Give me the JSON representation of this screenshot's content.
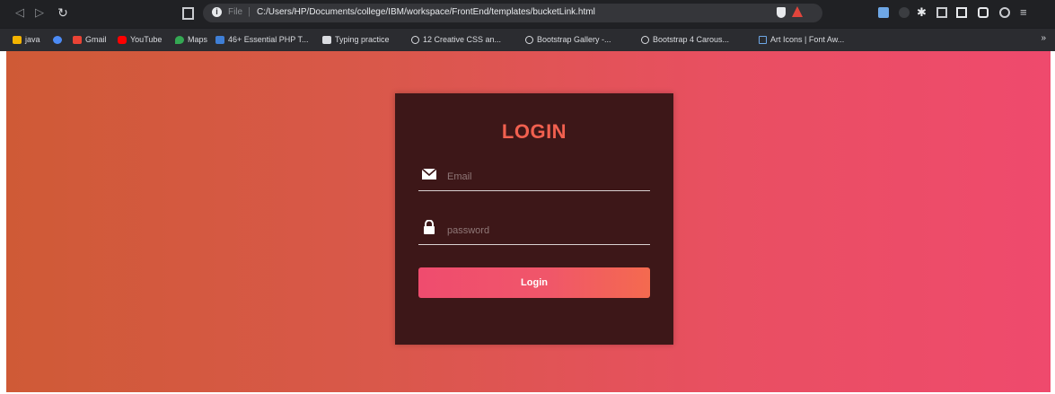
{
  "browser": {
    "url_scheme": "File",
    "url": "C:/Users/HP/Documents/college/IBM/workspace/FrontEnd/templates/bucketLink.html",
    "bookmarks": [
      {
        "label": "java",
        "color": "#f4b400"
      },
      {
        "label": "",
        "color": "#4c8bf5"
      },
      {
        "label": "Gmail",
        "color": "#ea4335"
      },
      {
        "label": "YouTube",
        "color": "#ff0000"
      },
      {
        "label": "Maps",
        "color": "#34a853"
      },
      {
        "label": "46+ Essential PHP T...",
        "color": "#3f7fd6"
      },
      {
        "label": "Typing practice",
        "color": "#dadce0"
      },
      {
        "label": "12 Creative CSS an...",
        "color": "#dadce0"
      },
      {
        "label": "Bootstrap Gallery -...",
        "color": "#dadce0"
      },
      {
        "label": "Bootstrap 4 Carous...",
        "color": "#dadce0"
      },
      {
        "label": "Art Icons | Font Aw...",
        "color": "#6ea7e6"
      }
    ]
  },
  "login": {
    "title": "LOGIN",
    "email_placeholder": "Email",
    "password_placeholder": "password",
    "button_label": "Login"
  },
  "colors": {
    "title": "#f1604f",
    "card": "#3d1718",
    "background_start": "#cf5a36",
    "background_end": "#ef4a6d"
  }
}
